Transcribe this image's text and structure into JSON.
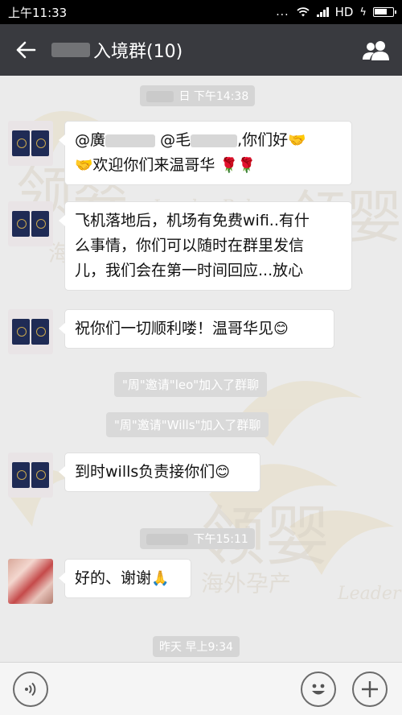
{
  "status_bar": {
    "time": "上午11:33",
    "dots": "...",
    "network": "HD"
  },
  "app_bar": {
    "title": "入境群(10)"
  },
  "messages": [
    {
      "time": "日 下午14:38"
    },
    {
      "line1_prefix": "@廣",
      "line1_mid": "@毛",
      "line1_suffix": ",你们好",
      "line2": "欢迎你们来温哥华"
    },
    {
      "lines": [
        "飞机落地后，机场有免费wifi..有什",
        "么事情，你们可以随时在群里发信",
        "儿，我们会在第一时间回应...放心"
      ]
    },
    {
      "text": "祝你们一切顺利喽！温哥华见"
    },
    {
      "system1": "\"周\"邀请\"leo\"加入了群聊",
      "system2": "\"周\"邀请\"Wills\"加入了群聊"
    },
    {
      "text": "到时wills负责接你们"
    },
    {
      "time": "下午15:11"
    },
    {
      "text": "好的、谢谢"
    },
    {
      "time": "昨天 早上9:34"
    }
  ],
  "watermark": {
    "text": "领婴",
    "sub": "海外孕产",
    "latin": "Leader Baby"
  },
  "colors": {
    "app_bar": "#393a3f",
    "chat_bg": "#ebebeb",
    "status_bar": "#000000"
  }
}
